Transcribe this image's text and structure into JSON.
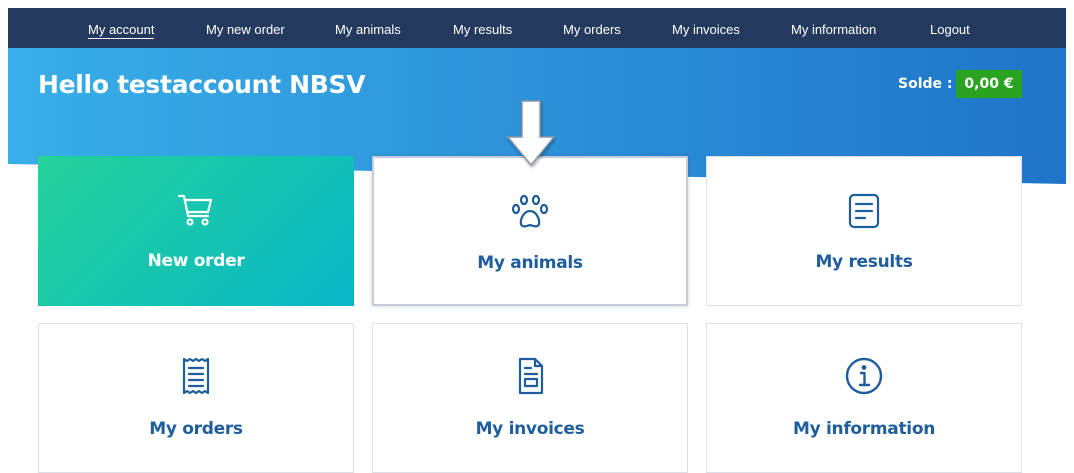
{
  "nav": {
    "items": [
      {
        "label": "My account",
        "active": true
      },
      {
        "label": "My new order"
      },
      {
        "label": "My animals"
      },
      {
        "label": "My results"
      },
      {
        "label": "My orders"
      },
      {
        "label": "My invoices"
      },
      {
        "label": "My information"
      },
      {
        "label": "Logout"
      }
    ]
  },
  "header": {
    "greeting": "Hello testaccount NBSV",
    "solde_label": "Solde :",
    "solde_value": "0,00 €"
  },
  "cards": [
    {
      "label": "New order",
      "icon": "shopping-cart-icon"
    },
    {
      "label": "My animals",
      "icon": "paw-icon"
    },
    {
      "label": "My results",
      "icon": "document-lines-icon"
    },
    {
      "label": "My orders",
      "icon": "receipt-icon"
    },
    {
      "label": "My invoices",
      "icon": "invoice-icon"
    },
    {
      "label": "My information",
      "icon": "info-icon"
    }
  ],
  "colors": {
    "nav_bg": "#233a5e",
    "banner": "#2b8fd8",
    "card_label": "#1e5d9e",
    "new_order_gradient_start": "#24d29a",
    "new_order_gradient_end": "#0ab6c8",
    "solde_badge": "#2aa320"
  }
}
